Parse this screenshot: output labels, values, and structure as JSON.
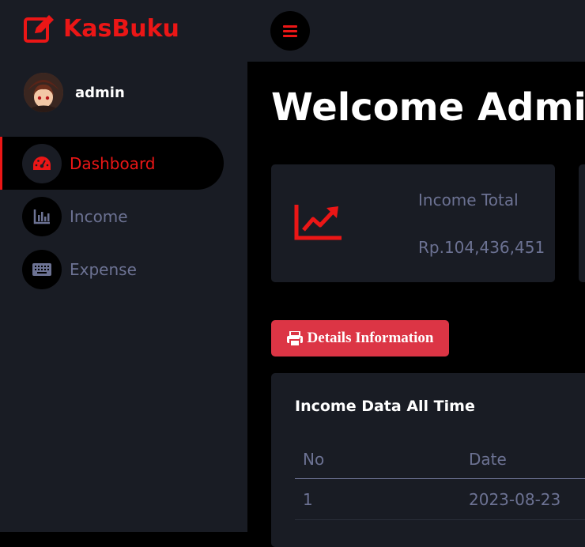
{
  "brand": {
    "name": "KasBuku",
    "icon": "edit-square-icon"
  },
  "user": {
    "name": "admin"
  },
  "nav": {
    "items": [
      {
        "label": "Dashboard",
        "icon": "speedometer-icon",
        "active": true
      },
      {
        "label": "Income",
        "icon": "bar-chart-icon",
        "active": false
      },
      {
        "label": "Expense",
        "icon": "keyboard-icon",
        "active": false
      }
    ]
  },
  "topbar": {
    "menu_icon": "hamburger-icon"
  },
  "main": {
    "heading": "Welcome Admin",
    "card": {
      "icon": "trend-up-icon",
      "title": "Income Total",
      "value": "Rp.104,436,451"
    },
    "details_button": "Details Information",
    "table": {
      "title": "Income Data All Time",
      "columns": [
        "No",
        "Date"
      ],
      "rows": [
        [
          "1",
          "2023-08-23"
        ]
      ]
    }
  },
  "colors": {
    "accent": "#eb1616",
    "sidebar_bg": "#191c24",
    "muted": "#6c7293",
    "button": "#dc3545"
  }
}
